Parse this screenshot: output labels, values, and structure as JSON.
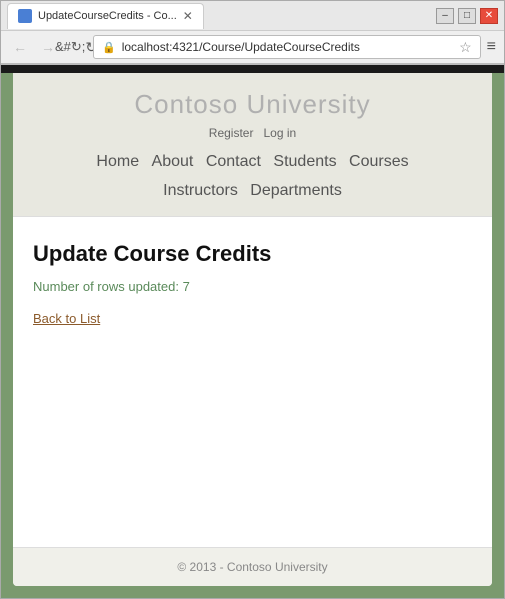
{
  "browser": {
    "tab_title": "UpdateCourseCredits - Co...",
    "tab_favicon": "page-icon",
    "url": "localhost:4321/Course/UpdateCourseCredits",
    "back_disabled": true,
    "forward_disabled": true,
    "window_controls": {
      "minimize": "–",
      "maximize": "□",
      "close": "✕"
    }
  },
  "site": {
    "title": "Contoso University",
    "auth": {
      "register": "Register",
      "login": "Log in"
    },
    "nav": {
      "home": "Home",
      "about": "About",
      "contact": "Contact",
      "students": "Students",
      "courses": "Courses",
      "instructors": "Instructors",
      "departments": "Departments"
    },
    "page": {
      "heading": "Update Course Credits",
      "status": "Number of rows updated: 7",
      "back_link": "Back to List"
    },
    "footer": {
      "text": "© 2013 - Contoso University"
    }
  }
}
